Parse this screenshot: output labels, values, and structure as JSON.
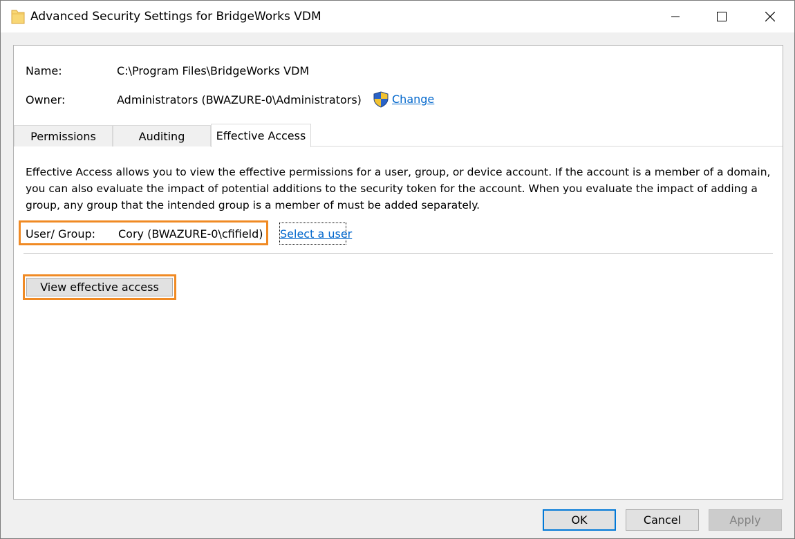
{
  "window": {
    "title": "Advanced Security Settings for BridgeWorks VDM"
  },
  "object": {
    "name_label": "Name:",
    "name_value": "C:\\Program Files\\BridgeWorks VDM",
    "owner_label": "Owner:",
    "owner_value": "Administrators (BWAZURE-0\\Administrators)",
    "change_label": "Change"
  },
  "tabs": [
    {
      "label": "Permissions",
      "active": false
    },
    {
      "label": "Auditing",
      "active": false
    },
    {
      "label": "Effective Access",
      "active": true
    }
  ],
  "effective_access": {
    "description": "Effective Access allows you to view the effective permissions for a user, group, or device account. If the account is a member of a domain, you can also evaluate the impact of potential additions to the security token for the account. When you evaluate the impact of adding a group, any group that the intended group is a member of must be added separately.",
    "user_group_label": "User/ Group:",
    "user_group_value": "Cory (BWAZURE-0\\cfifield)",
    "select_user_label": "Select a user",
    "view_button_label": "View effective access"
  },
  "footer": {
    "ok_label": "OK",
    "cancel_label": "Cancel",
    "apply_label": "Apply"
  },
  "colors": {
    "highlight": "#f08a24",
    "link": "#0066cc",
    "default_button_border": "#0078d7"
  },
  "icons": {
    "title": "folder-icon",
    "owner_change": "uac-shield-icon"
  }
}
